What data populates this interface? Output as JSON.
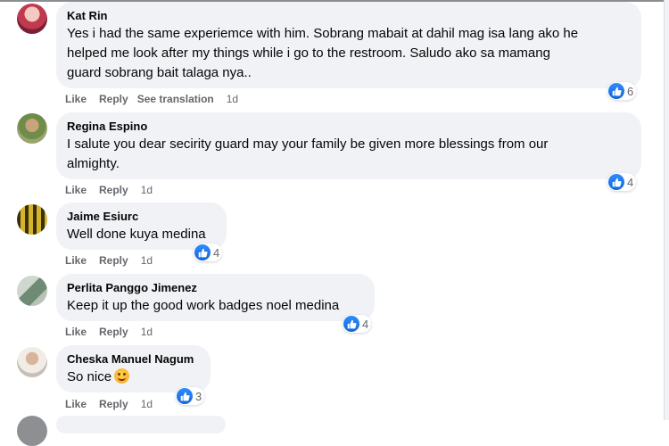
{
  "colors": {
    "bubble": "#f0f2f5",
    "meta": "#65676b",
    "like": "#1877f2"
  },
  "actions": {
    "like_label": "Like",
    "reply_label": "Reply",
    "see_translation_label": "See translation"
  },
  "comments": [
    {
      "author": "Kat Rin",
      "text_lines": [
        "Yes i had the same experiemce with him. Sobrang mabait at dahil mag isa lang ako he",
        "helped me look after my things while i go to the restroom. Saludo ako sa mamang",
        "guard sobrang bait talaga nya.."
      ],
      "time": "1d",
      "reaction_icon": "like-icon",
      "reaction_count": "6"
    },
    {
      "author": "Regina Espino",
      "text_lines": [
        "I salute you dear secirity guard may your family be given more blessings from our",
        "almighty."
      ],
      "time": "1d",
      "reaction_icon": "like-icon",
      "reaction_count": "4"
    },
    {
      "author": "Jaime Esiurc",
      "text_lines": [
        "Well done kuya medina"
      ],
      "time": "1d",
      "reaction_icon": "like-icon",
      "reaction_count": "4"
    },
    {
      "author": "Perlita Panggo Jimenez",
      "text_lines": [
        "Keep it up the good work badges noel medina"
      ],
      "time": "1d",
      "reaction_icon": "like-icon",
      "reaction_count": "4"
    },
    {
      "author": "Cheska Manuel Nagum",
      "text_lines": [
        "So nice"
      ],
      "emoji": "smiling-face-emoji",
      "time": "1d",
      "reaction_icon": "like-icon",
      "reaction_count": "3"
    }
  ]
}
